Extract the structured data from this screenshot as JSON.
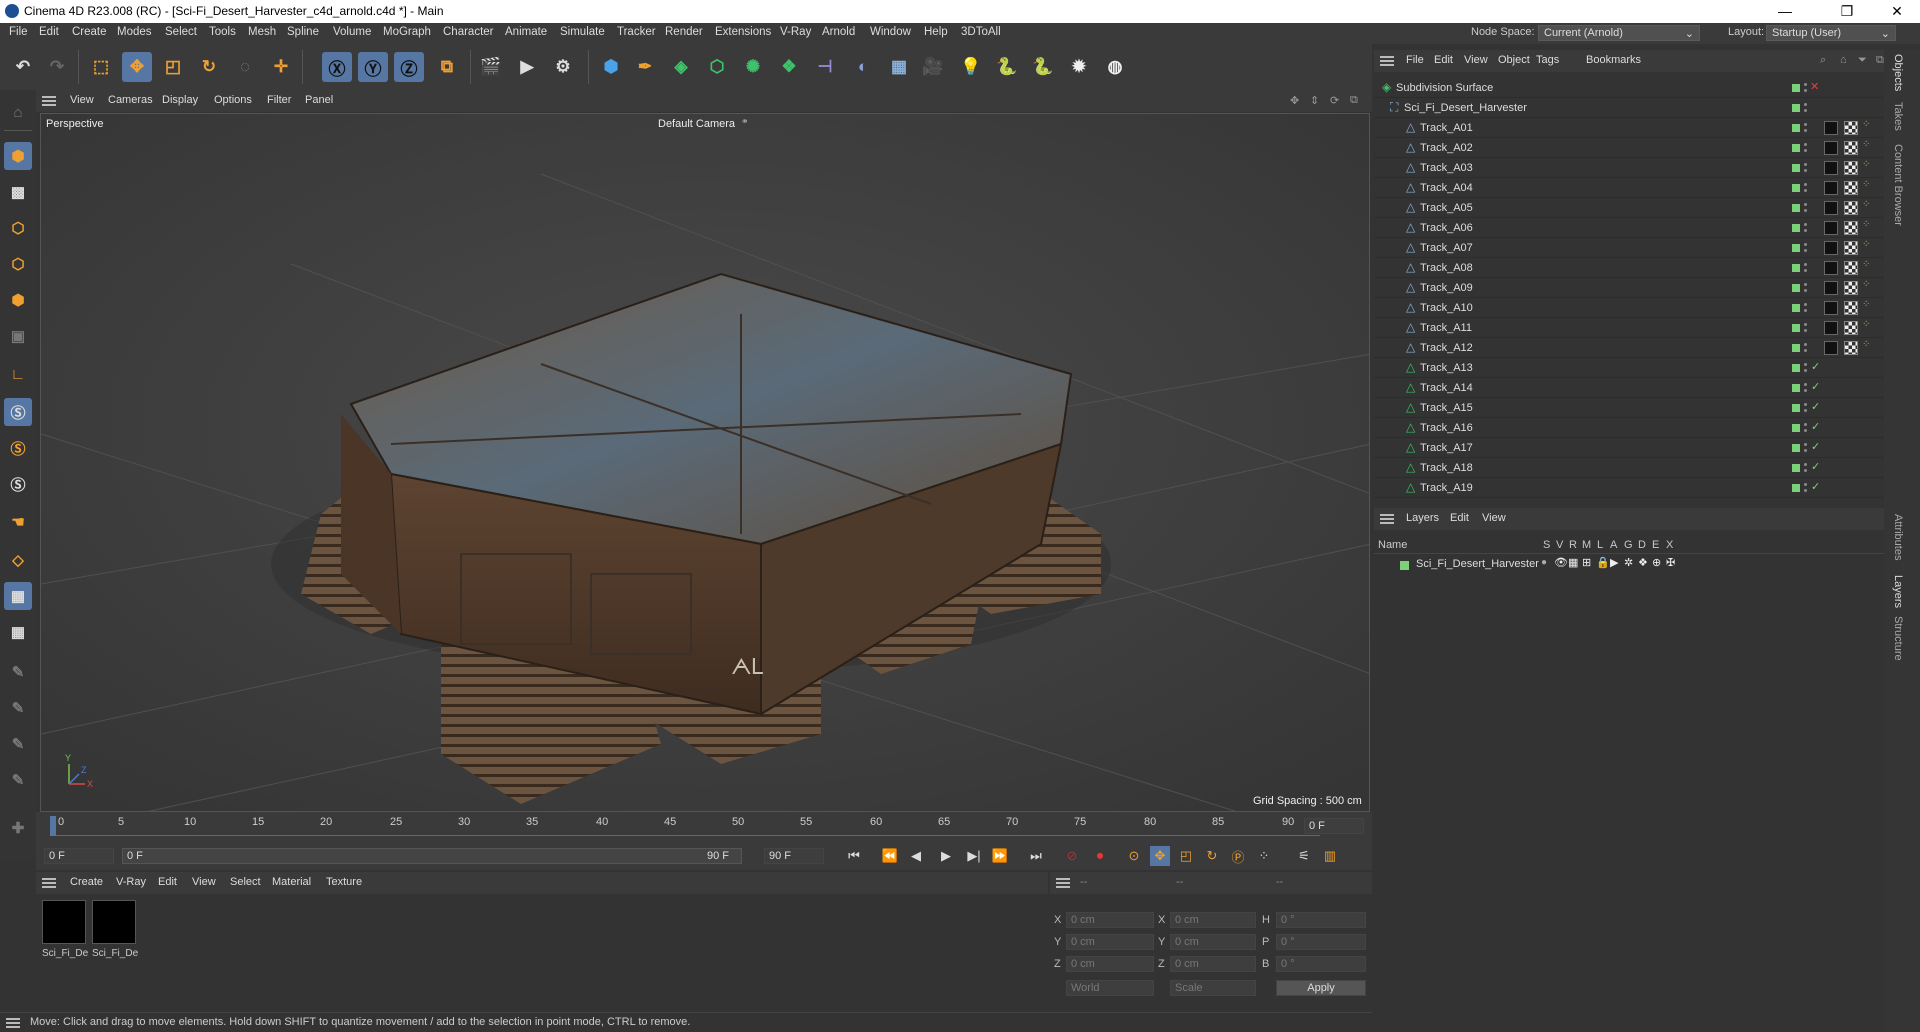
{
  "window": {
    "title": "Cinema 4D R23.008 (RC) - [Sci-Fi_Desert_Harvester_c4d_arnold.c4d *] - Main"
  },
  "menubar": {
    "items": [
      "File",
      "Edit",
      "Create",
      "Modes",
      "Select",
      "Tools",
      "Mesh",
      "Spline",
      "Volume",
      "MoGraph",
      "Character",
      "Animate",
      "Simulate",
      "Tracker",
      "Render",
      "Extensions",
      "V-Ray",
      "Arnold",
      "Window",
      "Help",
      "3DToAll"
    ],
    "node_space_label": "Node Space:",
    "node_space_value": "Current (Arnold)",
    "layout_label": "Layout:",
    "layout_value": "Startup (User)"
  },
  "viewport": {
    "menu": [
      "View",
      "Cameras",
      "Display",
      "Options",
      "Filter",
      "Panel"
    ],
    "name": "Perspective",
    "camera": "Default Camera",
    "grid_spacing": "Grid Spacing : 500 cm",
    "model_marking": "ᗅᏞ"
  },
  "timeline": {
    "ticks": [
      "0",
      "5",
      "10",
      "15",
      "20",
      "25",
      "30",
      "35",
      "40",
      "45",
      "50",
      "55",
      "60",
      "65",
      "70",
      "75",
      "80",
      "85",
      "90"
    ],
    "current_frame": "0 F",
    "start_frame": "0 F",
    "range_start": "0 F",
    "range_end": "90 F",
    "end_frame": "90 F"
  },
  "material_panel": {
    "menu": [
      "Create",
      "V-Ray",
      "Edit",
      "View",
      "Select",
      "Material",
      "Texture"
    ],
    "materials": [
      {
        "label": "Sci_Fi_De"
      },
      {
        "label": "Sci_Fi_De"
      }
    ]
  },
  "coord_panel": {
    "header_dashes": [
      "--",
      "--",
      "--"
    ],
    "rows": [
      {
        "a": "X",
        "av": "0 cm",
        "b": "X",
        "bv": "0 cm",
        "c": "H",
        "cv": "0 °"
      },
      {
        "a": "Y",
        "av": "0 cm",
        "b": "Y",
        "bv": "0 cm",
        "c": "P",
        "cv": "0 °"
      },
      {
        "a": "Z",
        "av": "0 cm",
        "b": "Z",
        "bv": "0 cm",
        "c": "B",
        "cv": "0 °"
      }
    ],
    "space": "World",
    "mode": "Scale",
    "apply": "Apply"
  },
  "status": "Move: Click and drag to move elements. Hold down SHIFT to quantize movement / add to the selection in point mode, CTRL to remove.",
  "objects_panel": {
    "menu": [
      "File",
      "Edit",
      "View",
      "Object",
      "Tags",
      "Bookmarks"
    ],
    "root": "Subdivision Surface",
    "group": "Sci_Fi_Desert_Harvester",
    "tracks": [
      "Track_A01",
      "Track_A02",
      "Track_A03",
      "Track_A04",
      "Track_A05",
      "Track_A06",
      "Track_A07",
      "Track_A08",
      "Track_A09",
      "Track_A10",
      "Track_A11",
      "Track_A12",
      "Track_A13",
      "Track_A14",
      "Track_A15",
      "Track_A16",
      "Track_A17",
      "Track_A18",
      "Track_A19"
    ]
  },
  "layers_panel": {
    "menu": [
      "Layers",
      "Edit",
      "View"
    ],
    "col_name": "Name",
    "cols": [
      "S",
      "V",
      "R",
      "M",
      "L",
      "A",
      "G",
      "D",
      "E",
      "X"
    ],
    "layer": "Sci_Fi_Desert_Harvester"
  },
  "right_dock": [
    "Objects",
    "Takes",
    "Content Browser",
    "Attributes",
    "Layers",
    "Structure"
  ],
  "colors": {
    "accent": "#5677a3",
    "layer_green": "#7ad17a",
    "bg": "#333333"
  }
}
